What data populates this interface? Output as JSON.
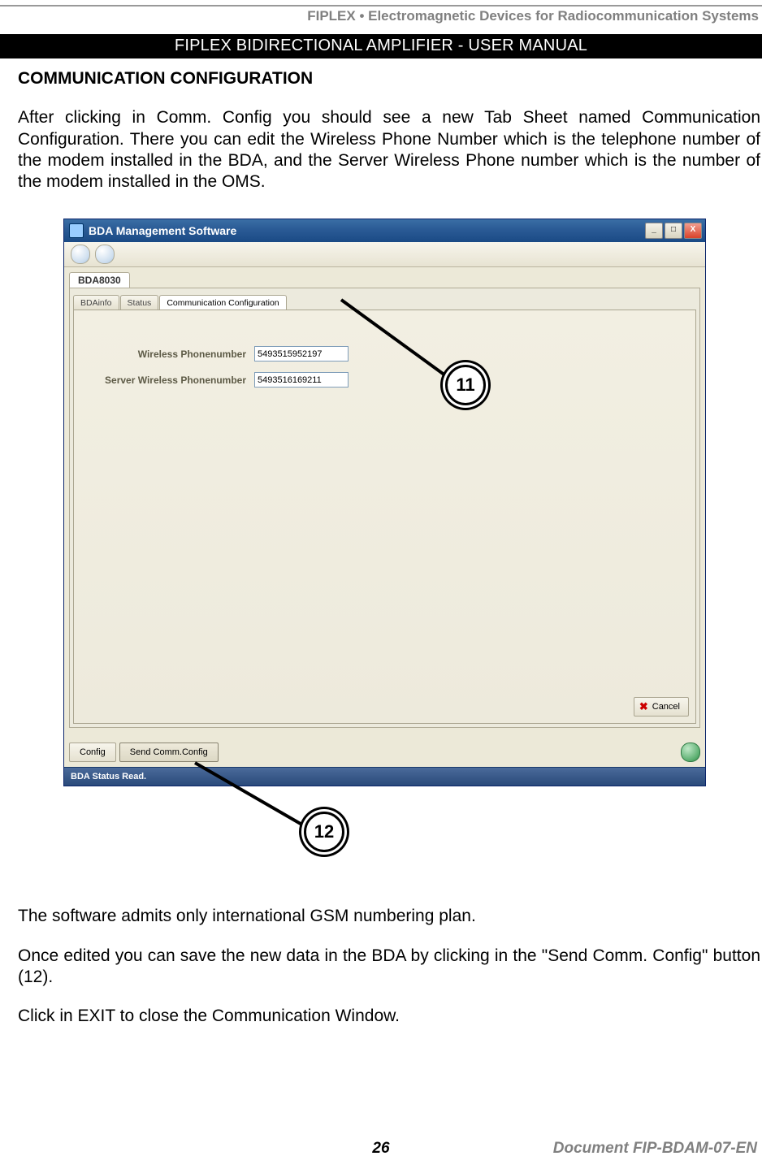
{
  "header": {
    "brand_line": "FIPLEX • Electromagnetic Devices for Radiocommunication Systems",
    "black_bar": "FIPLEX BIDIRECTIONAL AMPLIFIER -  USER MANUAL"
  },
  "section": {
    "title": "COMMUNICATION CONFIGURATION",
    "p1": "After clicking in Comm. Config you should see a new Tab Sheet named Communication Configuration.  There you can edit the Wireless Phone Number which is the telephone number of the modem installed in the BDA, and the Server Wireless Phone number which is the number of the modem installed in the OMS.",
    "p2": "The software admits only international GSM numbering plan.",
    "p3": "Once edited you can save the new data in the BDA by clicking in the \"Send Comm. Config\" button (12).",
    "p4": "Click in EXIT to close the Communication Window."
  },
  "app": {
    "title": "BDA Management Software",
    "win_min": "_",
    "win_max": "□",
    "win_close": "X",
    "device_tab": "BDA8030",
    "subtabs": {
      "t1": "BDAinfo",
      "t2": "Status",
      "t3": "Communication Configuration"
    },
    "fields": {
      "wireless_label": "Wireless Phonenumber",
      "wireless_value": "5493515952197",
      "server_label": "Server Wireless Phonenumber",
      "server_value": "5493516169211"
    },
    "buttons": {
      "cancel": "Cancel",
      "config": "Config",
      "send": "Send Comm.Config"
    },
    "status": "BDA Status Read."
  },
  "callouts": {
    "c11": "11",
    "c12": "12"
  },
  "footer": {
    "page": "26",
    "doc": "Document FIP-BDAM-07-EN"
  }
}
